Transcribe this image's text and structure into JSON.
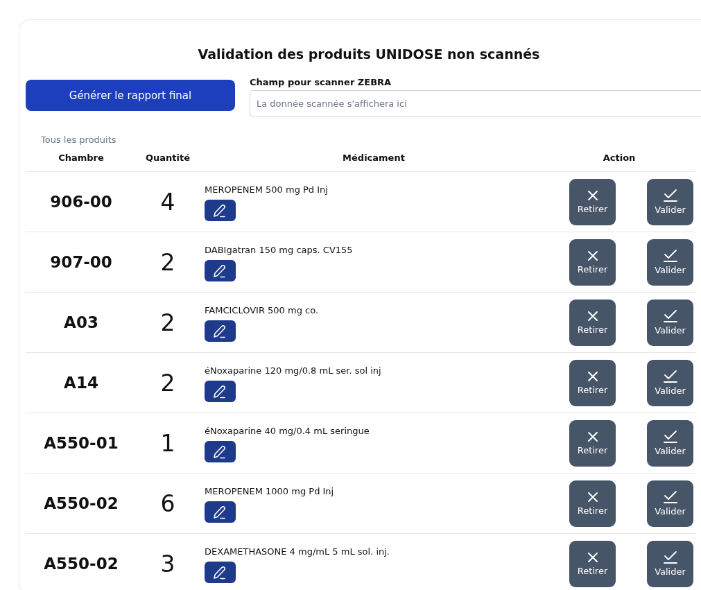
{
  "title": "Validation des produits UNIDOSE non scannés",
  "report_button": "Générer le rapport final",
  "scanner": {
    "label": "Champ pour scanner ZEBRA",
    "placeholder": "La donnée scannée s'affichera ici"
  },
  "filter_label": "Tous les produits",
  "columns": [
    "Chambre",
    "Quantité",
    "Médicament",
    "Action"
  ],
  "rows": [
    {
      "room": "906-00",
      "quantity": "4",
      "drug": "MEROPENEM 500 mg Pd Inj",
      "remove": "Retirer",
      "validate": "Valider"
    },
    {
      "room": "907-00",
      "quantity": "2",
      "drug": "DABIgatran 150 mg caps. CV155",
      "remove": "Retirer",
      "validate": "Valider"
    },
    {
      "room": "A03",
      "quantity": "2",
      "drug": "FAMCICLOVIR 500 mg co.",
      "remove": "Retirer",
      "validate": "Valider"
    },
    {
      "room": "A14",
      "quantity": "2",
      "drug": "éNoxaparine 120 mg/0.8 mL ser. sol inj",
      "remove": "Retirer",
      "validate": "Valider"
    },
    {
      "room": "A550-01",
      "quantity": "1",
      "drug": "éNoxaparine 40 mg/0.4 mL seringue",
      "remove": "Retirer",
      "validate": "Valider"
    },
    {
      "room": "A550-02",
      "quantity": "6",
      "drug": "MEROPENEM 1000 mg Pd Inj",
      "remove": "Retirer",
      "validate": "Valider"
    },
    {
      "room": "A550-02",
      "quantity": "3",
      "drug": "DEXAMETHASONE 4 mg/mL 5 mL sol. inj.",
      "remove": "Retirer",
      "validate": "Valider"
    }
  ]
}
